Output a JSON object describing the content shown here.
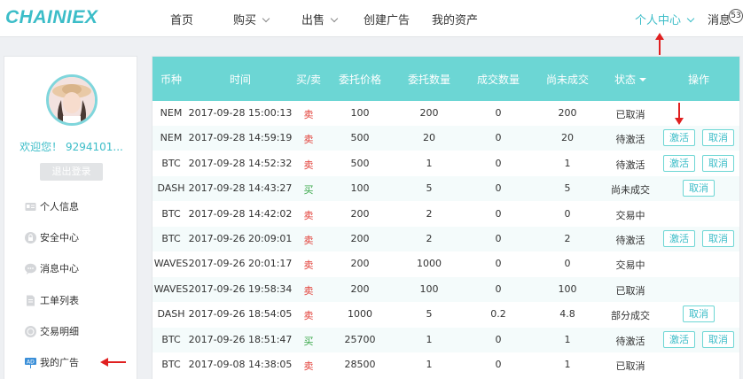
{
  "header": {
    "logo": "CHAINIEX",
    "nav": {
      "home": "首页",
      "buy": "购买",
      "sell": "出售",
      "create_ad": "创建广告",
      "assets": "我的资产",
      "user_center": "个人中心",
      "messages": "消息",
      "message_count": "53"
    }
  },
  "sidebar": {
    "welcome": "欢迎您！ 9294101...",
    "logout": "退出登录",
    "items": [
      {
        "label": "个人信息",
        "icon": "id-card-icon"
      },
      {
        "label": "安全中心",
        "icon": "lock-icon"
      },
      {
        "label": "消息中心",
        "icon": "chat-bubble-icon"
      },
      {
        "label": "工单列表",
        "icon": "document-icon"
      },
      {
        "label": "交易明细",
        "icon": "coin-icon"
      },
      {
        "label": "我的广告",
        "icon": "ad-icon"
      }
    ]
  },
  "table": {
    "headers": {
      "coin": "币种",
      "time": "时间",
      "side": "买/卖",
      "price": "委托价格",
      "amount": "委托数量",
      "filled": "成交数量",
      "unfilled": "尚未成交",
      "status": "状态",
      "action": "操作"
    },
    "buttons": {
      "activate": "激活",
      "cancel": "取消"
    },
    "rows": [
      {
        "coin": "NEM",
        "time": "2017-09-28 15:00:13",
        "side": "卖",
        "price": "100",
        "amount": "200",
        "filled": "0",
        "unfilled": "200",
        "status": "已取消"
      },
      {
        "coin": "NEM",
        "time": "2017-09-28 14:59:19",
        "side": "卖",
        "price": "500",
        "amount": "20",
        "filled": "0",
        "unfilled": "20",
        "status": "待激活"
      },
      {
        "coin": "BTC",
        "time": "2017-09-28 14:52:32",
        "side": "卖",
        "price": "500",
        "amount": "1",
        "filled": "0",
        "unfilled": "1",
        "status": "待激活"
      },
      {
        "coin": "DASH",
        "time": "2017-09-28 14:43:27",
        "side": "买",
        "price": "100",
        "amount": "5",
        "filled": "0",
        "unfilled": "5",
        "status": "尚未成交"
      },
      {
        "coin": "BTC",
        "time": "2017-09-28 14:42:02",
        "side": "卖",
        "price": "200",
        "amount": "2",
        "filled": "0",
        "unfilled": "0",
        "status": "交易中"
      },
      {
        "coin": "BTC",
        "time": "2017-09-26 20:09:01",
        "side": "卖",
        "price": "200",
        "amount": "2",
        "filled": "0",
        "unfilled": "2",
        "status": "待激活"
      },
      {
        "coin": "WAVES",
        "time": "2017-09-26 20:01:17",
        "side": "卖",
        "price": "200",
        "amount": "1000",
        "filled": "0",
        "unfilled": "0",
        "status": "交易中"
      },
      {
        "coin": "WAVES",
        "time": "2017-09-26 19:58:34",
        "side": "卖",
        "price": "200",
        "amount": "100",
        "filled": "0",
        "unfilled": "100",
        "status": "已取消"
      },
      {
        "coin": "DASH",
        "time": "2017-09-26 18:54:05",
        "side": "卖",
        "price": "1000",
        "amount": "5",
        "filled": "0.2",
        "unfilled": "4.8",
        "status": "部分成交"
      },
      {
        "coin": "BTC",
        "time": "2017-09-26 18:51:47",
        "side": "买",
        "price": "25700",
        "amount": "1",
        "filled": "0",
        "unfilled": "1",
        "status": "待激活"
      },
      {
        "coin": "BTC",
        "time": "2017-09-08 14:38:05",
        "side": "卖",
        "price": "28500",
        "amount": "1",
        "filled": "0",
        "unfilled": "1",
        "status": "已取消"
      }
    ]
  },
  "colors": {
    "accent": "#3cbdc8",
    "header_bg": "#6cd6d4",
    "sell": "#e2413a",
    "buy": "#3aa84a",
    "annotation": "#e02020"
  }
}
